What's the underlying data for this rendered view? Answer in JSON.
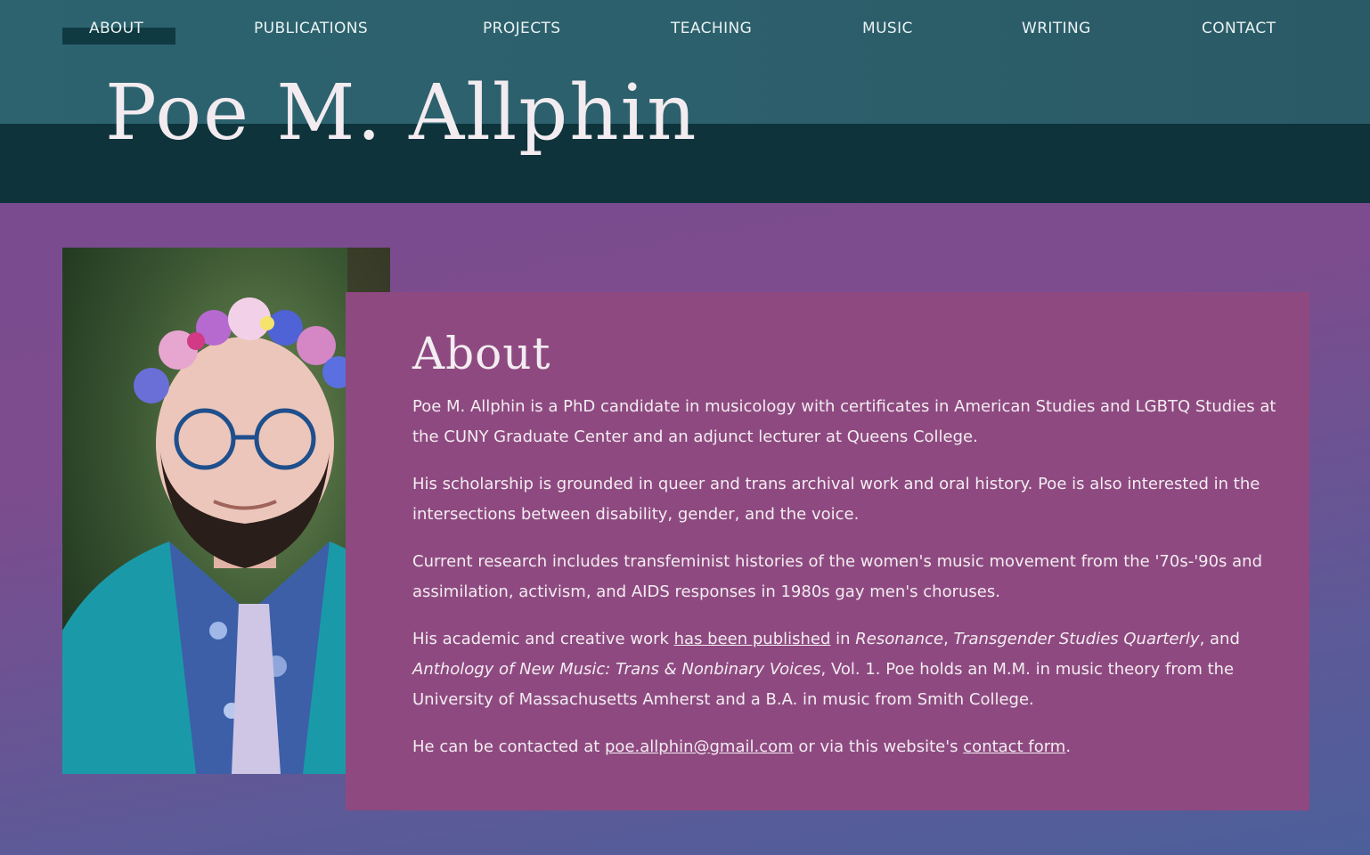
{
  "nav": {
    "items": [
      {
        "label": "ABOUT",
        "active": true
      },
      {
        "label": "PUBLICATIONS"
      },
      {
        "label": "PROJECTS"
      },
      {
        "label": "TEACHING"
      },
      {
        "label": "MUSIC"
      },
      {
        "label": "WRITING"
      },
      {
        "label": "CONTACT"
      }
    ]
  },
  "site_title": "Poe M. Allphin",
  "photo": {
    "alt": "Portrait photo"
  },
  "about": {
    "heading": "About",
    "p1": "Poe M. Allphin is a PhD candidate in musicology with certificates in American Studies and LGBTQ Studies at the CUNY Graduate Center and an adjunct lecturer at Queens College.",
    "p2": "His scholarship is grounded in queer and trans archival work and oral history. Poe is also interested in the intersections between disability, gender, and the voice.",
    "p3": "Current research includes transfeminist histories of the women's music movement from the '70s-'90s and assimilation, activism, and AIDS responses in 1980s gay men's choruses.",
    "p4": {
      "t1": "His academic and creative work ",
      "link": "has been published",
      "t2": " in ",
      "pub1": "Resonance",
      "t3": ", ",
      "pub2": "Transgender Studies Quarterly",
      "t4": ", and ",
      "pub3": "Anthology of New Music: Trans & Nonbinary Voices",
      "t5": ", Vol. 1. Poe holds an M.M. in music theory from the University of Massachusetts Amherst and a B.A. in music from Smith College."
    },
    "p5": {
      "t1": "He can be contacted at ",
      "email": "poe.allphin@gmail.com",
      "t2": " or via this website's ",
      "link": "contact form",
      "t3": "."
    }
  },
  "colors": {
    "header_top": "#2c636f",
    "header_bottom": "#0e333b",
    "card": "#8e4a80",
    "page_bg": "#7a4a92",
    "text_light": "#f3ecf1"
  }
}
